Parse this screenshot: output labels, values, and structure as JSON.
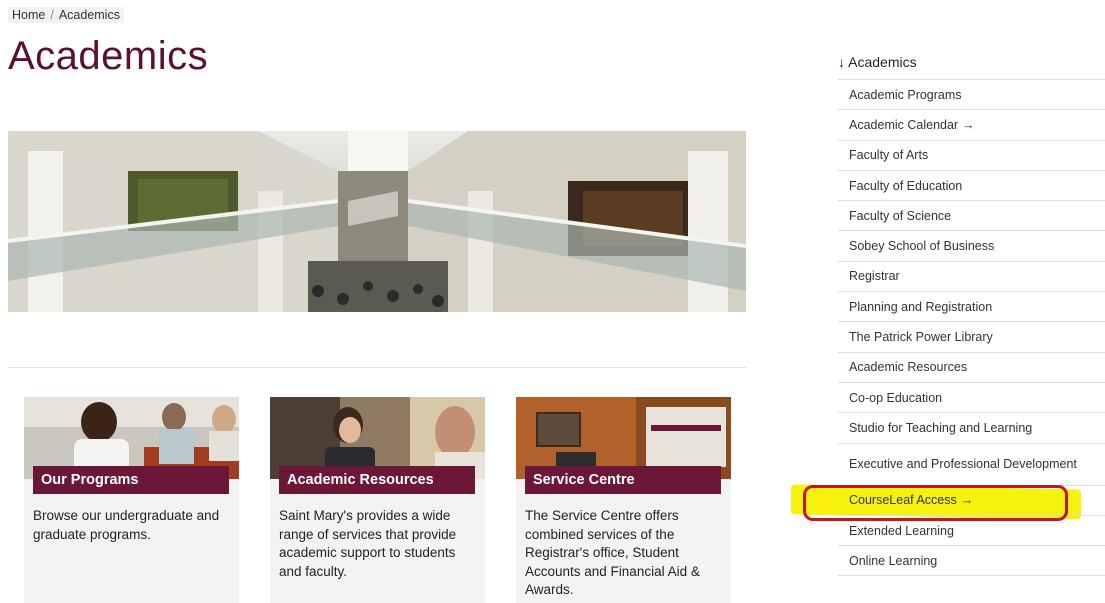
{
  "breadcrumb": {
    "home": "Home",
    "separator": "/",
    "current": "Academics"
  },
  "page_title": "Academics",
  "cards": [
    {
      "title": "Our Programs",
      "description": "Browse our undergraduate and graduate programs."
    },
    {
      "title": "Academic Resources",
      "description": "Saint Mary's provides a wide range of services that provide academic support to students and faculty."
    },
    {
      "title": "Service Centre",
      "description": "The Service Centre offers combined services of the Registrar's office, Student Accounts and Financial Aid & Awards."
    }
  ],
  "sidebar": {
    "heading_icon": "↓",
    "heading": "Academics",
    "items": [
      {
        "label": "Academic Programs",
        "arrow": ""
      },
      {
        "label": "Academic Calendar",
        "arrow": "→"
      },
      {
        "label": "Faculty of Arts",
        "arrow": ""
      },
      {
        "label": "Faculty of Education",
        "arrow": ""
      },
      {
        "label": "Faculty of Science",
        "arrow": ""
      },
      {
        "label": "Sobey School of Business",
        "arrow": ""
      },
      {
        "label": "Registrar",
        "arrow": ""
      },
      {
        "label": "Planning and Registration",
        "arrow": ""
      },
      {
        "label": "The Patrick Power Library",
        "arrow": ""
      },
      {
        "label": "Academic Resources",
        "arrow": ""
      },
      {
        "label": "Co-op Education",
        "arrow": ""
      },
      {
        "label": "Studio for Teaching and Learning",
        "arrow": ""
      },
      {
        "label": "Executive and Professional Development",
        "arrow": ""
      },
      {
        "label": "CourseLeaf Access",
        "arrow": "→"
      },
      {
        "label": "Extended Learning",
        "arrow": ""
      },
      {
        "label": "Online Learning",
        "arrow": ""
      }
    ]
  },
  "colors": {
    "brand": "#6b1737",
    "title": "#5a1030",
    "highlight": "#f6f000",
    "annotation_box": "#c4151c"
  }
}
